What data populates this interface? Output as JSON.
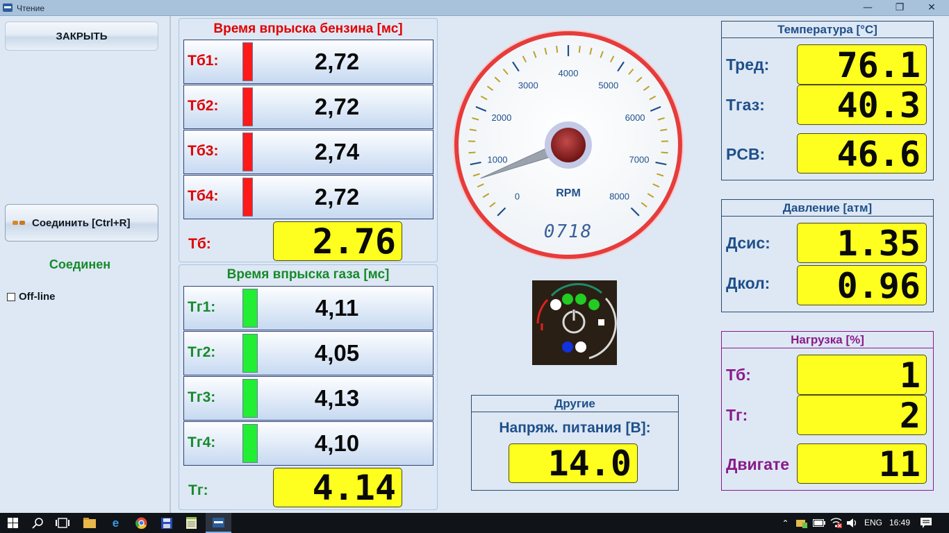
{
  "window": {
    "title": "Чтение",
    "minimize": "—",
    "restore": "❐",
    "close": "✕"
  },
  "left": {
    "close_button": "ЗАКРЫТЬ",
    "connect_button": "Соединить [Ctrl+R]",
    "status": "Соединен",
    "offline_label": "Off-line",
    "offline_checked": false
  },
  "petrol": {
    "title": "Время впрыска бензина [мс]",
    "color": "#e00000",
    "rows": [
      {
        "label": "Тб1:",
        "value": "2,72"
      },
      {
        "label": "Тб2:",
        "value": "2,72"
      },
      {
        "label": "Тб3:",
        "value": "2,74"
      },
      {
        "label": "Тб4:",
        "value": "2,72"
      }
    ],
    "sum_label": "Тб:",
    "sum_value": "2.76"
  },
  "gas": {
    "title": "Время впрыска газа [мс]",
    "color": "#168a2a",
    "rows": [
      {
        "label": "Тг1:",
        "value": "4,11"
      },
      {
        "label": "Тг2:",
        "value": "4,05"
      },
      {
        "label": "Тг3:",
        "value": "4,13"
      },
      {
        "label": "Тг4:",
        "value": "4,10"
      }
    ],
    "sum_label": "Тг:",
    "sum_value": "4.14"
  },
  "gauge": {
    "unit": "RPM",
    "rpm": 718,
    "readout": "0718",
    "max": 8000,
    "ticks": [
      "0",
      "1000",
      "2000",
      "3000",
      "4000",
      "5000",
      "6000",
      "7000",
      "8000"
    ]
  },
  "other": {
    "title": "Другие",
    "voltage_label": "Напряж. питания [В]:",
    "voltage_value": "14.0"
  },
  "temperature": {
    "title": "Температура [°C]",
    "rows": [
      {
        "label": "Тред:",
        "value": "76.1"
      },
      {
        "label": "Тгаз:",
        "value": "40.3"
      },
      {
        "label": "PCB:",
        "value": "46.6"
      }
    ]
  },
  "pressure": {
    "title": "Давление [атм]",
    "rows": [
      {
        "label": "Дсис:",
        "value": "1.35"
      },
      {
        "label": "Дкол:",
        "value": "0.96"
      }
    ]
  },
  "load": {
    "title": "Нагрузка [%]",
    "rows": [
      {
        "label": "Тб:",
        "value": "1"
      },
      {
        "label": "Тг:",
        "value": "2"
      },
      {
        "label": "Двигате",
        "value": "11"
      }
    ]
  },
  "taskbar": {
    "lang": "ENG",
    "time": "16:49"
  },
  "colors": {
    "blue_title": "#1f4f8a",
    "load_purple": "#8a1a8a",
    "gas_bar": "#22ee33",
    "petrol_bar": "#ff1a1a",
    "readout_yellow": "#ffff1f"
  }
}
